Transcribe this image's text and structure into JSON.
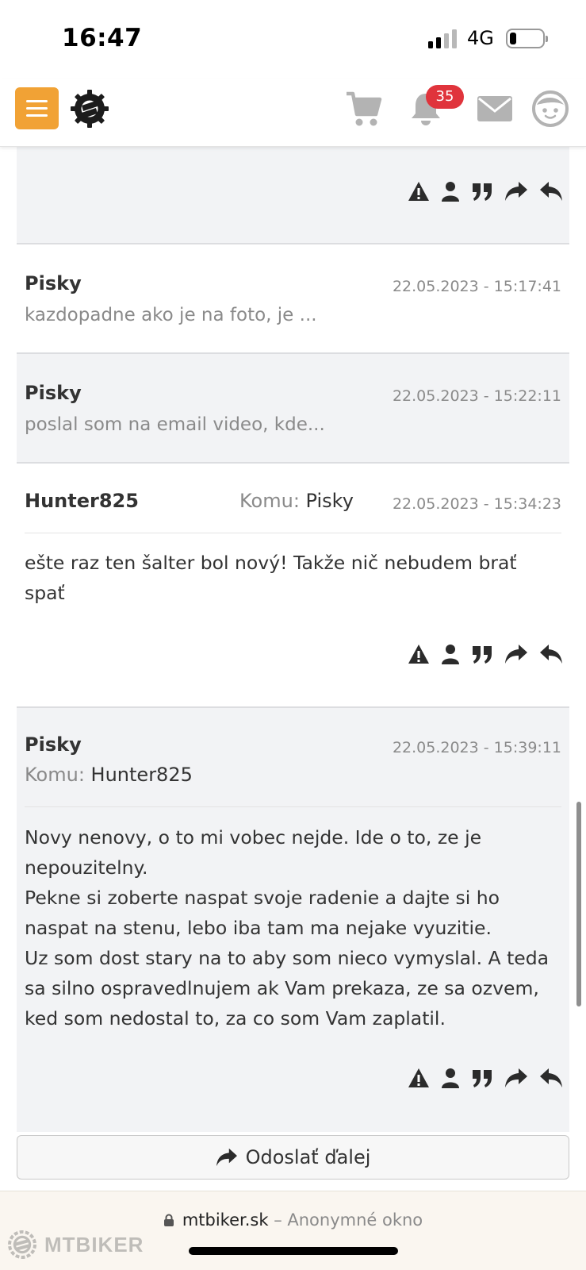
{
  "status_bar": {
    "time": "16:47",
    "network": "4G"
  },
  "header": {
    "notifications_count": "35",
    "icons": [
      "menu-icon",
      "mtbiker-logo-icon",
      "cart-icon",
      "bell-icon",
      "mail-icon",
      "avatar-icon"
    ],
    "menu_button_color": "#f1a235",
    "badge_color": "#e0343c"
  },
  "messages": [
    {
      "author": "Pisky",
      "date": "22.05.2023 - 15:17:41",
      "preview": "kazdopadne ako je na foto, je ..."
    },
    {
      "author": "Pisky",
      "date": "22.05.2023 - 15:22:11",
      "preview": "poslal som na email video, kde..."
    },
    {
      "author": "Hunter825",
      "to_label": "Komu:",
      "to": "Pisky",
      "date": "22.05.2023 - 15:34:23",
      "body": [
        "ešte raz ten šalter bol nový! Takže nič nebudem brať spať"
      ]
    },
    {
      "author": "Pisky",
      "to_label": "Komu:",
      "to": "Hunter825",
      "date": "22.05.2023 - 15:39:11",
      "body": [
        "Novy nenovy, o to mi vobec nejde. Ide o to, ze je nepouzitelny.",
        "Pekne si zoberte naspat svoje radenie a dajte si ho naspat na stenu, lebo iba tam ma nejake vyuzitie.",
        "Uz som dost stary na to aby som nieco vymyslal. A teda sa silno ospravedlnujem ak Vam prekaza, ze sa ozvem, ked som nedostal to, za co som Vam zaplatil."
      ]
    }
  ],
  "message_actions": [
    "report-icon",
    "user-icon",
    "quote-icon",
    "forward-icon",
    "reply-icon"
  ],
  "forward_button": {
    "label": "Odoslať ďalej"
  },
  "browser": {
    "domain": "mtbiker.sk",
    "mode": "– Anonymné okno"
  },
  "watermark": "MTBIKER"
}
